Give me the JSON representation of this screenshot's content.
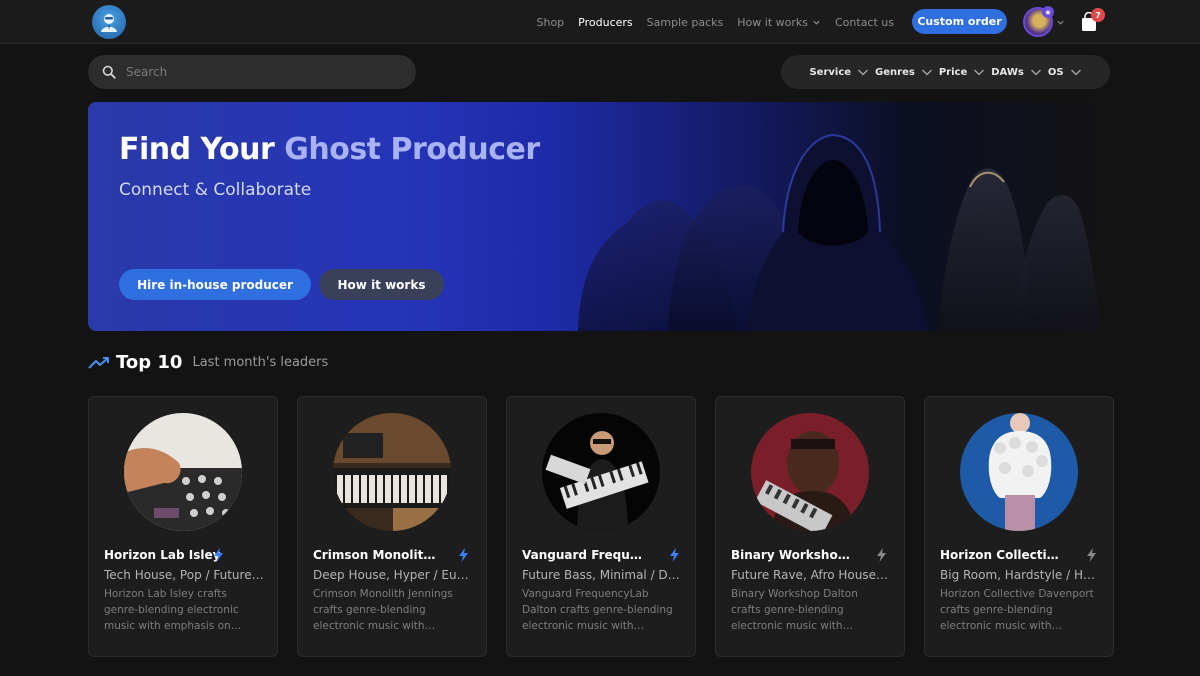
{
  "nav": {
    "items": [
      {
        "label": "Shop"
      },
      {
        "label": "Producers"
      },
      {
        "label": "Sample packs"
      },
      {
        "label": "How it works"
      },
      {
        "label": "Contact us"
      }
    ],
    "custom_order_label": "Custom order",
    "cart_count": "7",
    "avatar_badge": "★"
  },
  "search": {
    "placeholder": "Search"
  },
  "filters": [
    "Service",
    "Genres",
    "Price",
    "DAWs",
    "OS"
  ],
  "hero": {
    "title_plain": "Find Your ",
    "title_accent": "Ghost Producer",
    "subtitle": "Connect & Collaborate",
    "primary_button": "Hire in-house producer",
    "secondary_button": "How it works"
  },
  "top10": {
    "title": "Top 10",
    "subtitle": "Last month's leaders"
  },
  "producers": [
    {
      "name": "Horizon Lab Isley",
      "genres": "Tech House, Pop / Future House",
      "description": "Horizon Lab Isley crafts genre-blending electronic music with emphasis on quality.",
      "bolt_color": "#3b82f6"
    },
    {
      "name": "Crimson Monolith Jennings",
      "genres": "Deep House, Hyper / Euro Dance",
      "description": "Crimson Monolith Jennings crafts genre-blending electronic music with emphasis.",
      "bolt_color": "#3b82f6"
    },
    {
      "name": "Vanguard FrequencyLab Dalton",
      "genres": "Future Bass, Minimal / Deep House",
      "description": "Vanguard FrequencyLab Dalton crafts genre-blending electronic music with emphasis.",
      "bolt_color": "#3b82f6"
    },
    {
      "name": "Binary Workshop Dalton",
      "genres": "Future Rave, Afro House, Techno",
      "description": "Binary Workshop Dalton crafts genre-blending electronic music with emphasis.",
      "bolt_color": "#8a8a8a"
    },
    {
      "name": "Horizon Collective Davenport",
      "genres": "Big Room, Hardstyle / House",
      "description": "Horizon Collective Davenport crafts genre-blending electronic music with emphasis.",
      "bolt_color": "#8a8a8a"
    }
  ]
}
